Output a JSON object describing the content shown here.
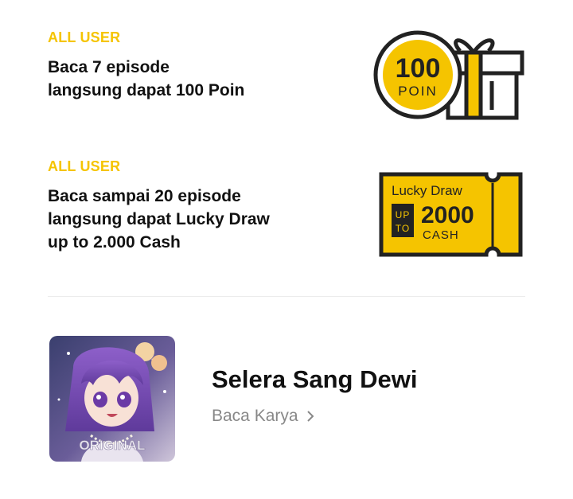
{
  "promos": [
    {
      "tag": "ALL USER",
      "description": "Baca 7 episode\nlangsung dapat 100 Poin",
      "icon": "coin-gift-icon",
      "coin_value": "100",
      "coin_unit": "POIN"
    },
    {
      "tag": "ALL USER",
      "description": "Baca sampai 20 episode\nlangsung dapat Lucky Draw\nup to 2.000 Cash",
      "icon": "ticket-icon",
      "ticket_title": "Lucky Draw",
      "ticket_up": "UP",
      "ticket_to": "TO",
      "ticket_amount": "2000",
      "ticket_unit": "CASH"
    }
  ],
  "work": {
    "cover_badge": "ORIGINAL",
    "title": "Selera Sang Dewi",
    "link_label": "Baca Karya"
  },
  "colors": {
    "accent": "#f5c400",
    "text": "#111111",
    "muted": "#888888"
  }
}
